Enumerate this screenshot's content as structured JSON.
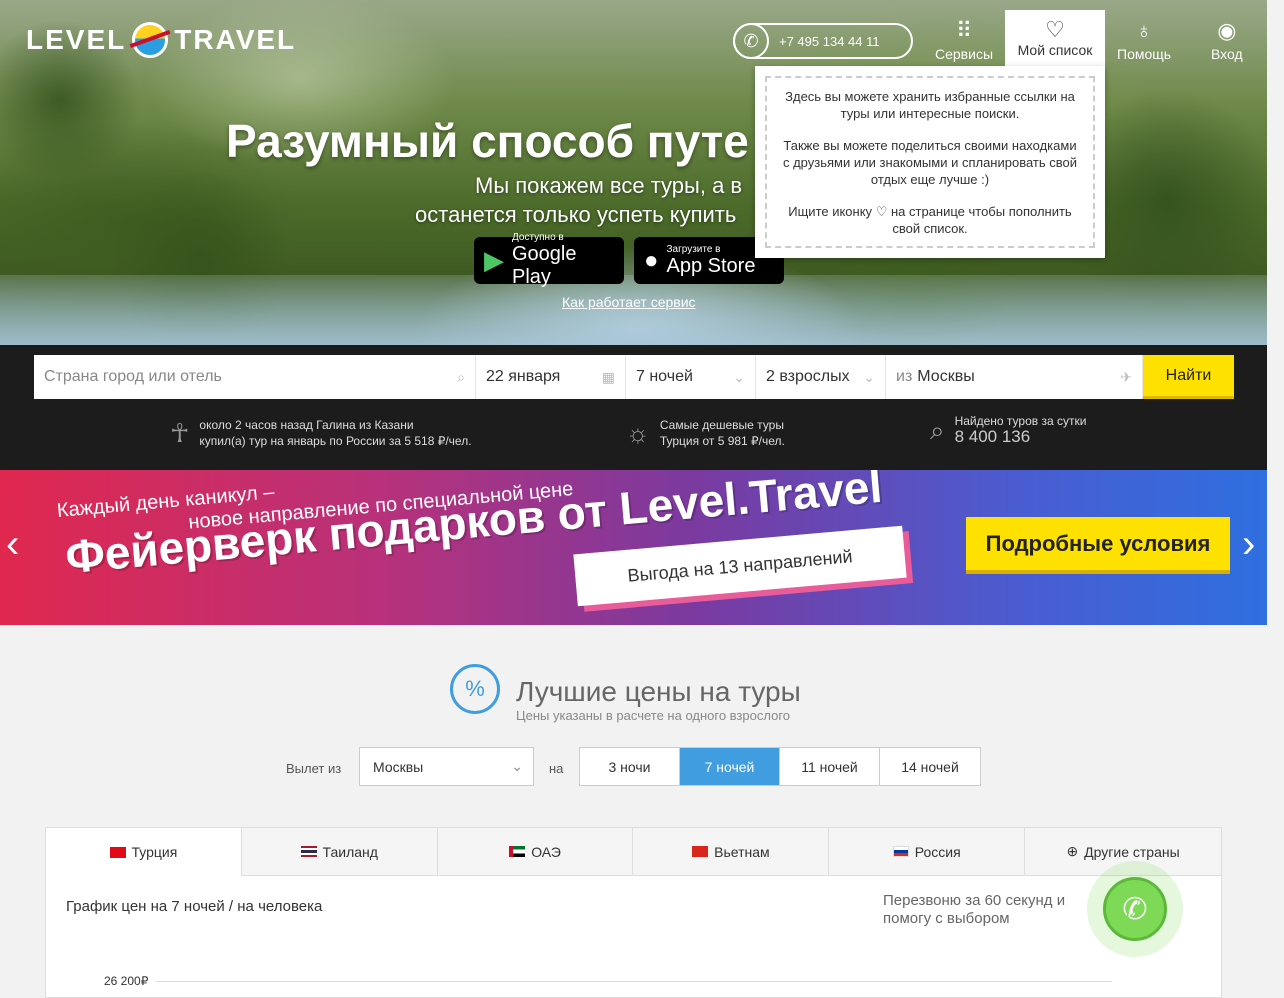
{
  "header": {
    "logo_left": "LEVEL",
    "logo_right": "TRAVEL",
    "phone": "+7 495 134 44 11",
    "nav": [
      {
        "label": "Сервисы",
        "icon": "grid-icon"
      },
      {
        "label": "Мой список",
        "icon": "heart-icon"
      },
      {
        "label": "Помощь",
        "icon": "lightbulb-icon"
      },
      {
        "label": "Вход",
        "icon": "user-icon"
      }
    ]
  },
  "popup": {
    "p1": "Здесь вы можете хранить избранные ссылки на туры или интересные поиски.",
    "p2": "Также вы можете поделиться своими находками с друзьями или знакомыми и спланировать свой отдых еще лучше :)",
    "p3_before": "Ищите иконку",
    "p3_after": "на странице чтобы пополнить свой список."
  },
  "hero": {
    "title": "Разумный способ путе",
    "sub1": "Мы покажем все туры, а в",
    "sub2": "останется только успеть купить",
    "google_small": "Доступно в",
    "google_big": "Google Play",
    "apple_small": "Загрузите в",
    "apple_big": "App Store",
    "how_link": "Как работает сервис"
  },
  "search": {
    "destination_placeholder": "Страна город или отель",
    "date": "22 января",
    "nights": "7 ночей",
    "guests": "2 взрослых",
    "from_prefix": "из",
    "from_city": "Москвы",
    "find_button": "Найти"
  },
  "ticker": {
    "item1_l1": "около 2 часов назад Галина из Казани",
    "item1_l2": "купил(а) тур на январь по России за 5 518 ₽/чел.",
    "item2_l1": "Самые дешевые туры",
    "item2_l2": "Турция от 5 981 ₽/чел.",
    "item3_l1": "Найдено туров за сутки",
    "item3_l2": "8 400 136"
  },
  "banner": {
    "line1a": "Каждый день каникул –",
    "line1b": "новое направление по специальной цене",
    "headline": "Фейерверк подарков от Level.Travel",
    "tag": "Выгода на 13 направлений",
    "cta": "Подробные условия"
  },
  "best_prices": {
    "title": "Лучшие цены на туры",
    "subtitle": "Цены указаны в расчете на одного взрослого",
    "departure_label": "Вылет из",
    "departure_value": "Москвы",
    "for_label": "на",
    "nights_options": [
      "3 ночи",
      "7 ночей",
      "11 ночей",
      "14 ночей"
    ],
    "nights_selected": "7 ночей"
  },
  "country_tabs": [
    "Турция",
    "Таиланд",
    "ОАЭ",
    "Вьетнам",
    "Россия",
    "Другие страны"
  ],
  "chart": {
    "caption": "График цен на 7 ночей / на человека",
    "callback_l1": "Перезвоню за 60 секунд и",
    "callback_l2": "помогу с выбором",
    "y_label": "26 200₽"
  }
}
